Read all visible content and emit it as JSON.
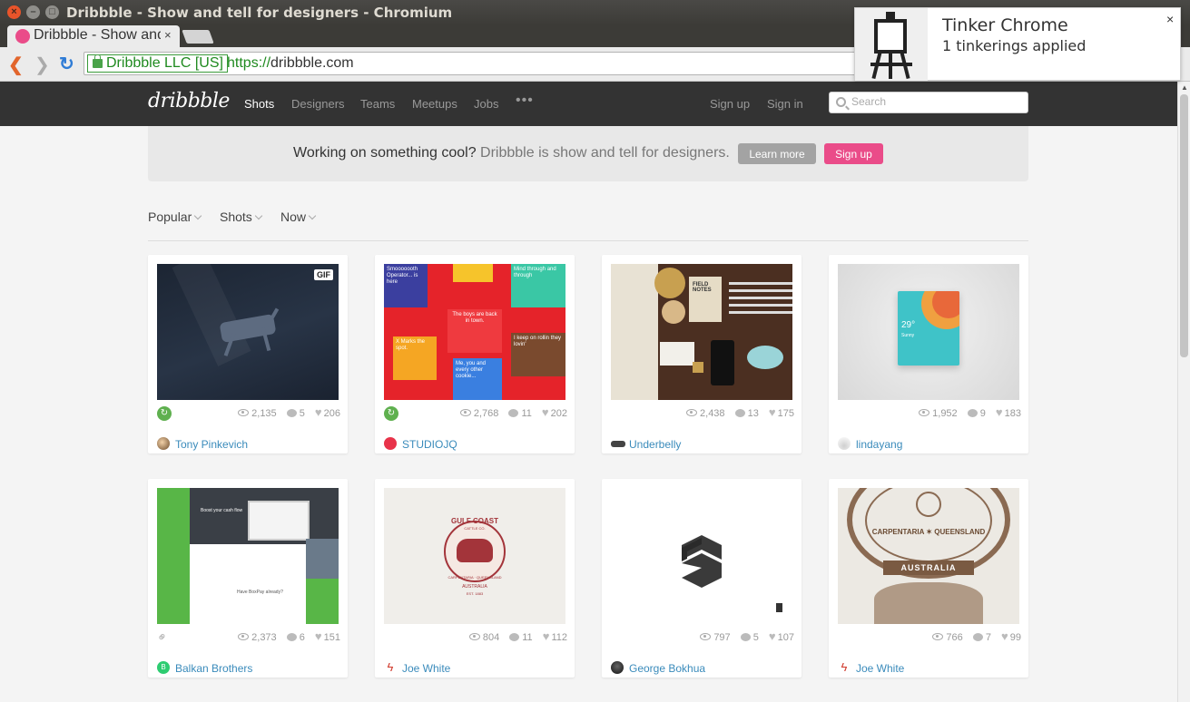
{
  "window": {
    "title": "Dribbble - Show and tell for designers - Chromium",
    "tab_title": "Dribbble - Show and tell for designers",
    "tab_close": "×"
  },
  "toolbar": {
    "ev_label": "Dribbble LLC [US]",
    "url_scheme": "https://",
    "url_host": "dribbble.com"
  },
  "notification": {
    "title": "Tinker Chrome",
    "message": "1 tinkerings applied",
    "close": "×"
  },
  "header": {
    "logo": "dribbble",
    "nav": [
      "Shots",
      "Designers",
      "Teams",
      "Meetups",
      "Jobs"
    ],
    "more": "•••",
    "signup": "Sign up",
    "signin": "Sign in",
    "search_placeholder": "Search"
  },
  "banner": {
    "strong": "Working on something cool?",
    "light": "Dribbble is show and tell for designers.",
    "learn_more": "Learn more",
    "signup": "Sign up"
  },
  "filters": [
    "Popular",
    "Shots",
    "Now"
  ],
  "shots": [
    {
      "author": "Tony Pinkevich",
      "views": "2,135",
      "comments": "5",
      "likes": "206",
      "badge": "GIF",
      "rebound": true
    },
    {
      "author": "STUDIOJQ",
      "views": "2,768",
      "comments": "11",
      "likes": "202",
      "rebound": true
    },
    {
      "author": "Underbelly",
      "views": "2,438",
      "comments": "13",
      "likes": "175"
    },
    {
      "author": "lindayang",
      "views": "1,952",
      "comments": "9",
      "likes": "183"
    },
    {
      "author": "Balkan Brothers",
      "views": "2,373",
      "comments": "6",
      "likes": "151",
      "attachment": true
    },
    {
      "author": "Joe White",
      "views": "804",
      "comments": "11",
      "likes": "112"
    },
    {
      "author": "George Bokhua",
      "views": "797",
      "comments": "5",
      "likes": "107"
    },
    {
      "author": "Joe White",
      "views": "766",
      "comments": "7",
      "likes": "99"
    }
  ],
  "art_text": {
    "red_cells": [
      "Smooooooth Operator... is here",
      "Mind through and through",
      "The boys are back in town.",
      "X Marks the spot.",
      "I keep on rollin they lovin'",
      "Me, you and every other cookie..."
    ],
    "desk_note": "FIELD NOTES",
    "phone_temp": "29°",
    "phone_sub": "Sunny",
    "gulf_top": "GULF COAST",
    "gulf_mid": "CATTLE CO.",
    "gulf_ring": "CARPENTARIA · QUEENSLAND",
    "gulf_bottom": "AUSTRALIA",
    "gulf_est": "EST. 1883",
    "engrave_top": "CARPENTARIA ✶ QUEENSLAND",
    "engrave_banner": "AUSTRALIA",
    "landing_title": "Boost your cash flow",
    "landing_question": "Have BoxPay already?"
  },
  "colors": {
    "brand_pink": "#ea4c89",
    "header_bg": "#333333",
    "link_blue": "#3a8bbb"
  }
}
